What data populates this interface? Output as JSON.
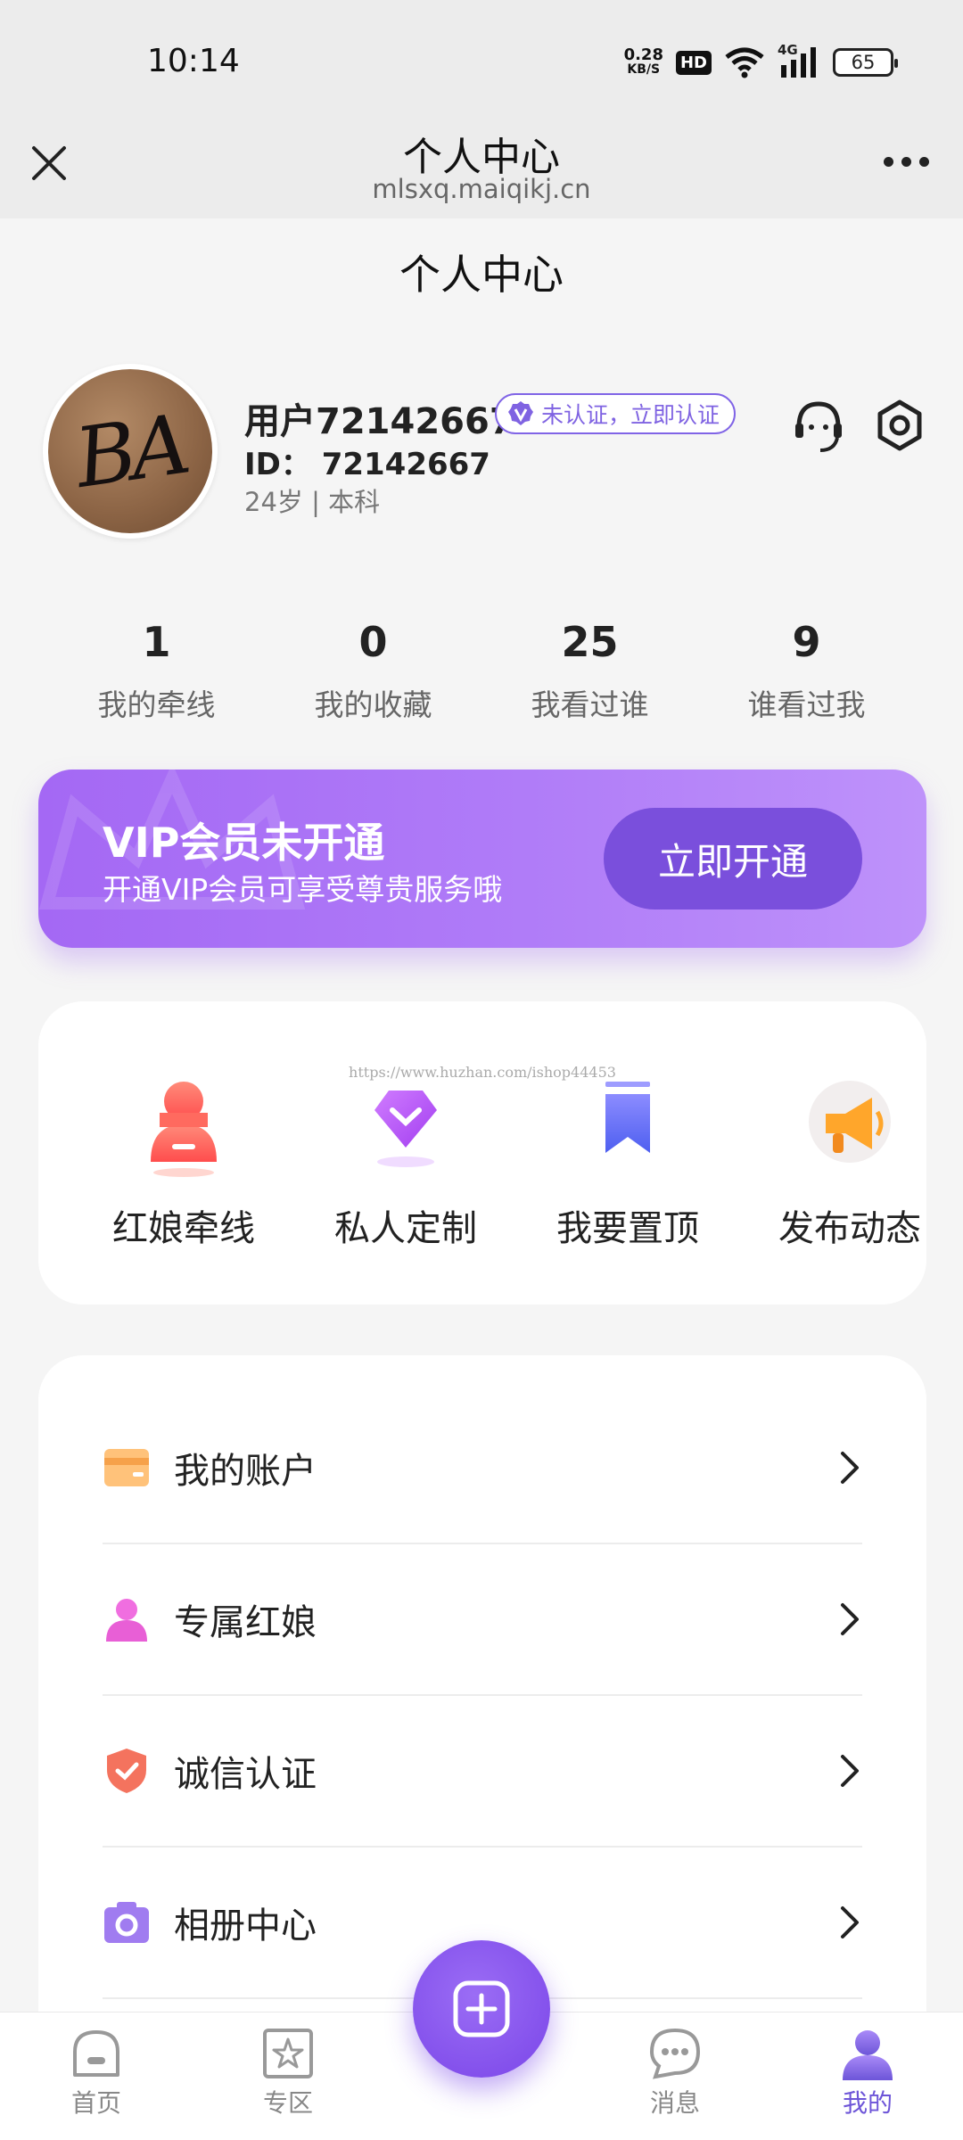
{
  "status_bar": {
    "time": "10:14",
    "speed_value": "0.28",
    "speed_unit": "KB/S",
    "hd": "HD",
    "network": "4G",
    "battery": "65"
  },
  "header": {
    "title": "个人中心",
    "url": "mlsxq.maiqikj.cn"
  },
  "page_title": "个人中心",
  "profile": {
    "name": "用户72142667",
    "verify_label": "未认证，立即认证",
    "id_text": "ID：  72142667",
    "meta": "24岁 | 本科",
    "avatar_text": "BA"
  },
  "stats": [
    {
      "value": "1",
      "label": "我的牵线"
    },
    {
      "value": "0",
      "label": "我的收藏"
    },
    {
      "value": "25",
      "label": "我看过谁"
    },
    {
      "value": "9",
      "label": "谁看过我"
    }
  ],
  "vip": {
    "title": "VIP会员未开通",
    "subtitle": "开通VIP会员可享受尊贵服务哦",
    "button": "立即开通"
  },
  "watermark": "https://www.huzhan.com/ishop44453",
  "quick_actions": [
    {
      "label": "红娘牵线",
      "icon": "matchmaker-icon"
    },
    {
      "label": "私人定制",
      "icon": "diamond-icon"
    },
    {
      "label": "我要置顶",
      "icon": "bookmark-icon"
    },
    {
      "label": "发布动态",
      "icon": "megaphone-icon"
    }
  ],
  "menu": [
    {
      "label": "我的账户",
      "icon": "wallet-icon",
      "color": "#f6a14a"
    },
    {
      "label": "专属红娘",
      "icon": "person-icon",
      "color": "#e85fd6"
    },
    {
      "label": "诚信认证",
      "icon": "shield-icon",
      "color": "#f4735e"
    },
    {
      "label": "相册中心",
      "icon": "camera-icon",
      "color": "#a07cf0"
    }
  ],
  "tabbar": [
    {
      "label": "首页",
      "icon": "home-icon",
      "active": false
    },
    {
      "label": "专区",
      "icon": "star-icon",
      "active": false
    },
    {
      "label": "消息",
      "icon": "message-icon",
      "active": false
    },
    {
      "label": "我的",
      "icon": "profile-icon",
      "active": true
    }
  ],
  "colors": {
    "accent": "#7a4fdc",
    "vip_start": "#a468f4",
    "vip_end": "#be92fa"
  }
}
